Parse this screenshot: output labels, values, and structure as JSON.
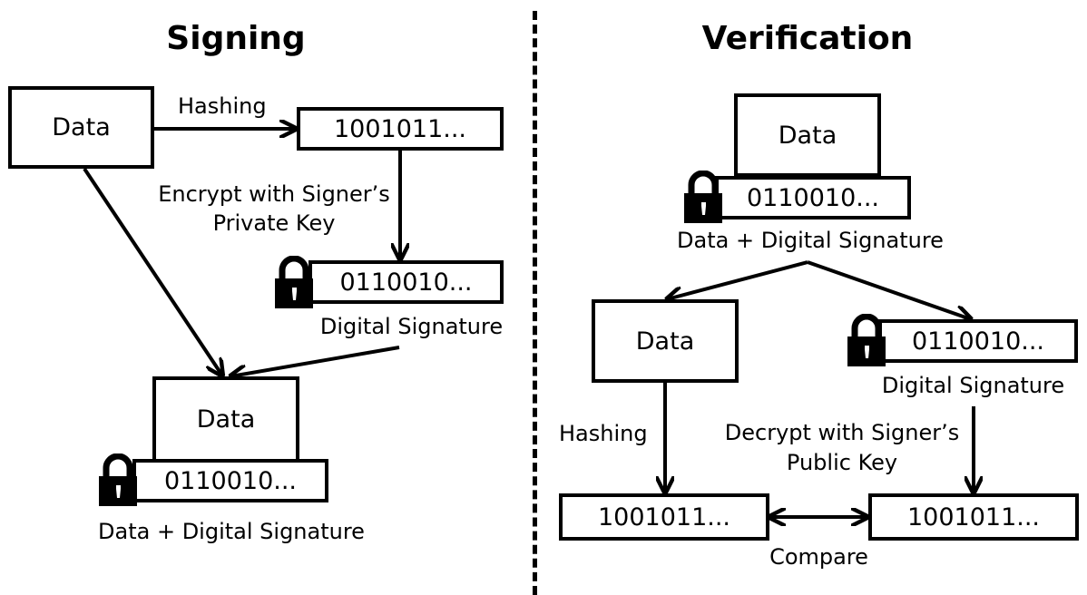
{
  "signing": {
    "title": "Signing",
    "data_box": "Data",
    "hashing_label": "Hashing",
    "hash_box": "1001011...",
    "encrypt_label_line1": "Encrypt with Signer’s",
    "encrypt_label_line2": "Private Key",
    "signature_box": "0110010...",
    "signature_label": "Digital Signature",
    "combined_data_box": "Data",
    "combined_signature_box": "0110010...",
    "combined_label": "Data + Digital Signature"
  },
  "verification": {
    "title": "Verification",
    "combined_data_box": "Data",
    "combined_signature_box": "0110010...",
    "combined_label": "Data + Digital Signature",
    "data_box": "Data",
    "signature_box": "0110010...",
    "signature_label": "Digital Signature",
    "hashing_label": "Hashing",
    "decrypt_label_line1": "Decrypt with Signer’s",
    "decrypt_label_line2": "Public Key",
    "hash_box_left": "1001011...",
    "hash_box_right": "1001011...",
    "compare_label": "Compare"
  },
  "icons": {
    "lock": "lock-icon"
  }
}
